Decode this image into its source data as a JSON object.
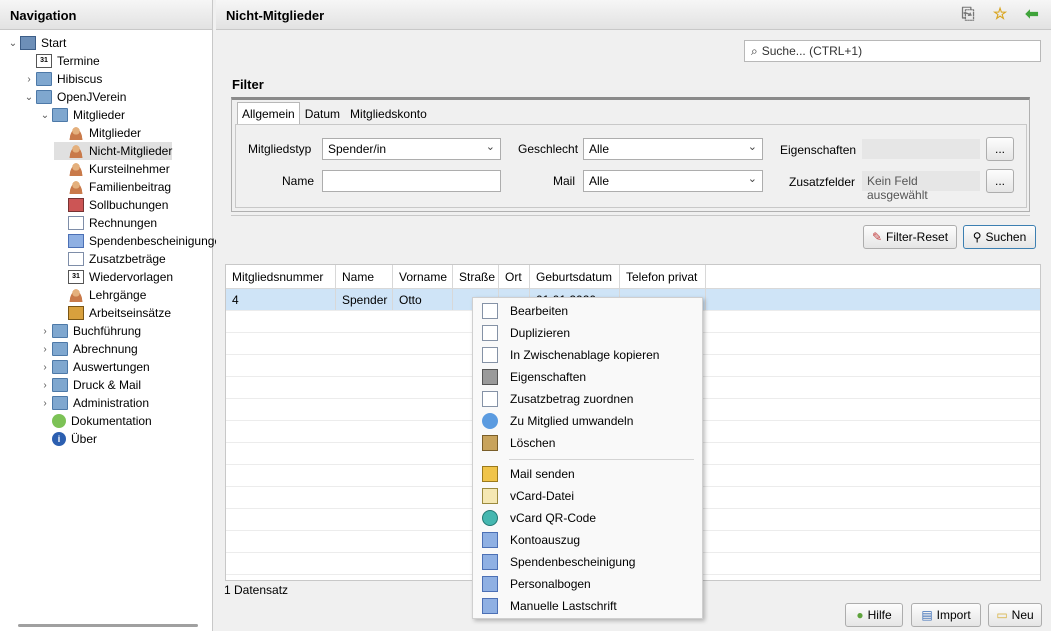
{
  "nav": {
    "title": "Navigation",
    "items": [
      {
        "label": "Start",
        "icon": "monitor-icon",
        "twisty": "⌄"
      },
      {
        "label": "Termine",
        "icon": "calendar-icon",
        "twisty": ""
      },
      {
        "label": "Hibiscus",
        "icon": "folder-icon",
        "twisty": "›"
      },
      {
        "label": "OpenJVerein",
        "icon": "folder-icon",
        "twisty": "⌄"
      },
      {
        "label": "Mitglieder",
        "icon": "folder-icon",
        "twisty": "⌄"
      },
      {
        "label": "Mitglieder",
        "icon": "members-icon",
        "twisty": ""
      },
      {
        "label": "Nicht-Mitglieder",
        "icon": "members-icon",
        "twisty": ""
      },
      {
        "label": "Kursteilnehmer",
        "icon": "members-icon",
        "twisty": ""
      },
      {
        "label": "Familienbeitrag",
        "icon": "members-icon",
        "twisty": ""
      },
      {
        "label": "Sollbuchungen",
        "icon": "ledger-icon",
        "twisty": ""
      },
      {
        "label": "Rechnungen",
        "icon": "document-icon",
        "twisty": ""
      },
      {
        "label": "Spendenbescheinigungen",
        "icon": "document-icon",
        "twisty": ""
      },
      {
        "label": "Zusatzbeträge",
        "icon": "document-icon",
        "twisty": ""
      },
      {
        "label": "Wiedervorlagen",
        "icon": "calendar-icon",
        "twisty": ""
      },
      {
        "label": "Lehrgänge",
        "icon": "course-icon",
        "twisty": ""
      },
      {
        "label": "Arbeitseinsätze",
        "icon": "work-icon",
        "twisty": ""
      },
      {
        "label": "Buchführung",
        "icon": "folder-icon",
        "twisty": "›"
      },
      {
        "label": "Abrechnung",
        "icon": "folder-icon",
        "twisty": "›"
      },
      {
        "label": "Auswertungen",
        "icon": "folder-icon",
        "twisty": "›"
      },
      {
        "label": "Druck & Mail",
        "icon": "folder-icon",
        "twisty": "›"
      },
      {
        "label": "Administration",
        "icon": "folder-icon",
        "twisty": "›"
      },
      {
        "label": "Dokumentation",
        "icon": "help-icon",
        "twisty": ""
      },
      {
        "label": "Über",
        "icon": "info-icon",
        "twisty": ""
      }
    ],
    "selected_index": 6
  },
  "main": {
    "title": "Nicht-Mitglieder",
    "search_placeholder": "Suche...    (CTRL+1)",
    "filter": {
      "title": "Filter",
      "tabs": [
        "Allgemein",
        "Datum",
        "Mitgliedskonto"
      ],
      "active_tab": "Allgemein",
      "mitgliedstyp_label": "Mitgliedstyp",
      "mitgliedstyp_value": "Spender/in",
      "name_label": "Name",
      "name_value": "",
      "geschlecht_label": "Geschlecht",
      "geschlecht_value": "Alle",
      "mail_label": "Mail",
      "mail_value": "Alle",
      "eigenschaften_label": "Eigenschaften",
      "eigenschaften_value": "",
      "zusatzfelder_label": "Zusatzfelder",
      "zusatzfelder_value": "Kein Feld ausgewählt",
      "ellipsis": "...",
      "reset_label": "Filter-Reset",
      "search_label": "Suchen"
    },
    "table": {
      "columns": [
        "Mitgliedsnummer",
        "Name",
        "Vorname",
        "Straße",
        "Ort",
        "Geburtsdatum",
        "Telefon privat"
      ],
      "rows": [
        [
          "4",
          "Spender",
          "Otto",
          "",
          "",
          "01.01.2020",
          ""
        ]
      ]
    },
    "status": "1 Datensatz",
    "buttons": {
      "help": "Hilfe",
      "import": "Import",
      "new": "Neu"
    }
  },
  "context_menu": {
    "items": [
      {
        "label": "Bearbeiten",
        "icon": "edit-icon"
      },
      {
        "label": "Duplizieren",
        "icon": "duplicate-icon"
      },
      {
        "label": "In Zwischenablage kopieren",
        "icon": "clipboard-icon"
      },
      {
        "label": "Eigenschaften",
        "icon": "properties-icon"
      },
      {
        "label": "Zusatzbetrag zuordnen",
        "icon": "extra-amount-icon"
      },
      {
        "label": "Zu Mitglied umwandeln",
        "icon": "convert-icon"
      },
      {
        "label": "Löschen",
        "icon": "delete-icon"
      },
      {
        "label": "Mail senden",
        "icon": "mail-icon"
      },
      {
        "label": "vCard-Datei",
        "icon": "vcard-icon"
      },
      {
        "label": "vCard QR-Code",
        "icon": "qr-code-icon"
      },
      {
        "label": "Kontoauszug",
        "icon": "account-statement-icon"
      },
      {
        "label": "Spendenbescheinigung",
        "icon": "donation-receipt-icon"
      },
      {
        "label": "Personalbogen",
        "icon": "personnel-sheet-icon"
      },
      {
        "label": "Manuelle Lastschrift",
        "icon": "direct-debit-icon"
      }
    ]
  },
  "colors": {
    "selection": "#cfe4f7",
    "header_gradient_top": "#f6f6f6",
    "accent": "#3c7fb1"
  }
}
